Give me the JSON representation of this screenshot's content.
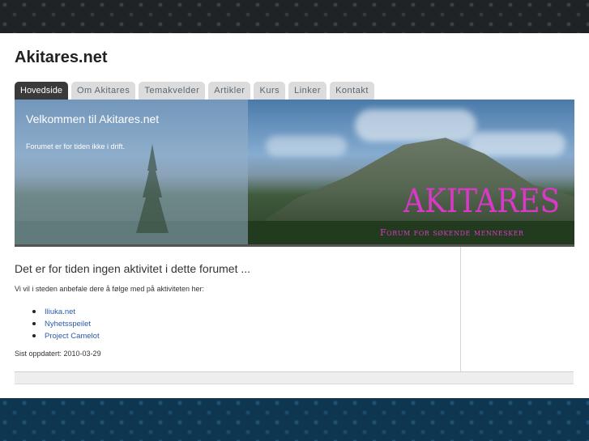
{
  "site": {
    "title": "Akitares.net"
  },
  "nav": {
    "tabs": [
      {
        "label": "Hovedside",
        "active": true
      },
      {
        "label": "Om Akitares",
        "active": false
      },
      {
        "label": "Temakvelder",
        "active": false
      },
      {
        "label": "Artikler",
        "active": false
      },
      {
        "label": "Kurs",
        "active": false
      },
      {
        "label": "Linker",
        "active": false
      },
      {
        "label": "Kontakt",
        "active": false
      }
    ]
  },
  "banner": {
    "heading": "Velkommen til Akitares.net",
    "text": "Forumet er for tiden ikke i drift.",
    "brand_name": "AKITARES",
    "brand_tagline": "Forum for søkende mennesker",
    "brand_color": "#d938c8"
  },
  "main": {
    "heading": "Det er for tiden ingen aktivitet i dette forumet ...",
    "intro": "Vi vil i steden anbefale dere å følge med på aktiviteten her:",
    "links": [
      "Iliuka.net",
      "Nyhetsspeilet",
      "Project Camelot"
    ],
    "updated": "Sist oppdatert: 2010-03-29"
  },
  "colors": {
    "link": "#2a5aa8",
    "active_tab": "#3a3a3a",
    "tab": "#dcdcdc",
    "bottom_band": "#0f3650",
    "top_band": "#1f2326"
  }
}
